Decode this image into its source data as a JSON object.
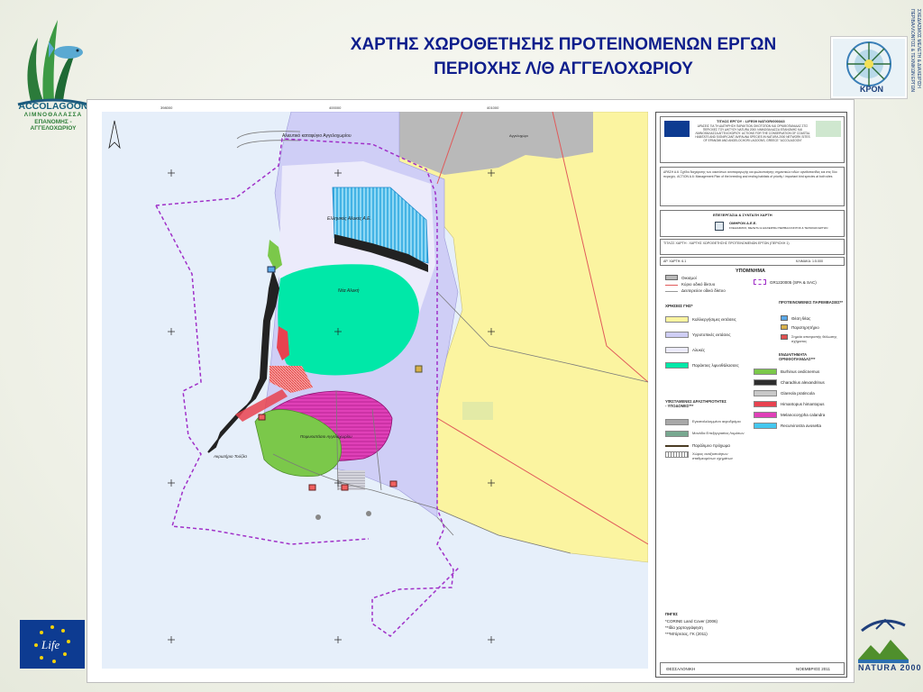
{
  "slide": {
    "title_line1": "ΧΑΡΤΗΣ ΧΩΡΟΘΕΤΗΣΗΣ ΠΡΟΤΕΙΝΟΜΕΝΩΝ ΕΡΓΩΝ",
    "title_line2": "ΠΕΡΙΟΧΗΣ Λ/Θ ΑΓΓΕΛΟΧΩΡΙΟΥ"
  },
  "logos": {
    "accolagoon_name": "ACCOLAGOON",
    "accolagoon_sub1": "ΛΙΜΝΟΘΑΛΑΣΣΑ",
    "accolagoon_sub2": "ΕΠΑΝΟΜΗΣ - ΑΓΓΕΛΟΧΩΡΙΟΥ",
    "kpon": "KPON",
    "right_vertical": "ΣΧΕΔΙΑΣΜΟΣ ΜΕΛΕΤΗ & ΔΙΑΧΕΙΡΙΣΗ ΠΕΡΙΒΑΛΛΟΝΤΟΣ & ΤΕΧΝΙΚΩΝ ΕΡΓΩΝ",
    "natura": "NATURA 2000",
    "life": "Life"
  },
  "map": {
    "grid_top": [
      "398000",
      "400000",
      "401000"
    ],
    "grid_left": [
      "4493000",
      "4491000",
      "4489000"
    ],
    "labels": {
      "fishery": "Αλιευτικό καταφύγιο Αγγελοχωρίου",
      "salt_company": "Ελληνικές Αλυκές Α.Ε.",
      "nw_salina": "Νέα Αλυκή",
      "lagoon": "Ποιμνιοστάσιο Αγγελοχωρίου",
      "cape": "Ακρωτήριο Τούζλα",
      "village": "Αγγελοχώρι"
    }
  },
  "legend": {
    "project_title": "ΤΙΤΛΟΣ ΕΡΓΟΥ : LIFE09 NAT/GR/000343",
    "project_desc": "ΔΡΑΣΕΙΣ ΓΙΑ ΤΗ ΔΙΑΤΗΡΗΣΗ ΠΑΡΑΚΤΙΩΝ ΟΙΚΟΤΟΠΩΝ ΚΑΙ ΟΡΝΙΘΟΠΑΝΙΔΑΣ ΣΤΙΣ ΠΕΡΙΟΧΕΣ ΤΟΥ ΔΙΚΤΥΟΥ NATURA 2000 ΛΙΜΝΟΘΑΛΑΣΣΑ ΕΠΑΝΟΜΗΣ ΚΑΙ ΛΙΜΝΟΘΑΛΑΣΣΑ ΑΓΓΕΛΟΧΩΡΙΟΥ. ACTIONS FOR THE CONSERVATION OF COASTAL HABITATS AND SIGNIFICANT AVIFAUNA SPECIES IN NATURA 2000 NETWORK SITES OF EPANOMI AND ANGELOCHORI LAGOONS, GREECE \"ACCOLAGOON\"",
    "action_desc": "ΔΡΑΣΗ Α.6: Σχέδιο διαχείρισης των οικοτόπων αναπαραγωγής και φωλεοποίησης σημαντικών ειδών ορνιθοπανίδας και στις δύο περιοχές. ACTION A.6: Management Plan of the breeding and resting habitats of priority / important bird species at both sites",
    "made_by_title": "ΕΠΕΞΕΡΓΑΣΙΑ & ΣΥΝΤΑΞΗ ΧΑΡΤΗ",
    "made_by_company": "ΟΜΗΡΟΝ Α.Ε.Ε.",
    "made_by_desc": "ΣΧΕΔΙΑΣΜΟΣ, ΜΕΛΕΤΗ & ΔΙΑΧΕΙΡΙΣΗ ΠΕΡΙΒΑΛΛΟΝΤΟΣ & ΤΕΧΝΙΚΩΝ ΕΡΓΩΝ",
    "map_title": "ΤΙΤΛΟΣ ΧΑΡΤΗ : ΧΑΡΤΗΣ ΧΩΡΟΘΕΤΗΣΗΣ ΠΡΟΤΕΙΝΟΜΕΝΩΝ ΕΡΓΩΝ (ΠΕΡΙΟΧΗ 1)",
    "map_no": "ΑΡ. ΧΑΡΤΗ: 6.1",
    "scale": "ΚΛΙΜΑΚΑ: 1:5.000",
    "heading": "ΥΠΟΜΝΗΜΑ",
    "legend_top": [
      {
        "label": "Οικισμοί",
        "color": "#b9b9b9"
      },
      {
        "label": "Κύριο οδικό δίκτυο",
        "color": "#e05a5a"
      },
      {
        "label": "Δευτερεύον οδικό δίκτυο",
        "color": "#999999"
      }
    ],
    "site_code": "GR1220005 (SPA & SAC)",
    "land_use_heading": "ΧΡΗΣΕΙΣ ΓΗΣ*",
    "land_use": [
      {
        "label": "Καλλιεργήσιμες εκτάσεις",
        "color": "#fbf4a0"
      },
      {
        "label": "Υγροτοπικές εκτάσεις",
        "color": "#cfcef6"
      },
      {
        "label": "Αλυκές",
        "color": "#ecebfb"
      },
      {
        "label": "Παράκτιες λιμνοθάλασσες",
        "color": "#00e8a8"
      }
    ],
    "proposed_heading": "ΠΡΟΤΕΙΝΟΜΕΝΕΣ ΠΑΡΕΜΒΑΣΕΙΣ**",
    "proposed": [
      {
        "label": "Θέση θέας",
        "color": "#5aa8e8"
      },
      {
        "label": "Παρατηρητήριο",
        "color": "#d8b04a"
      },
      {
        "label": "Σημεία αποτροπής θόλωσης σχήματος",
        "color": "#e05050"
      }
    ],
    "habitats_heading": "ΕΝΔΙΑΙΤΗΜΑΤΑ ΟΡΝΙΘΟΠΑΝΙΔΑΣ***",
    "habitats": [
      {
        "label": "Burhinus oedicnemus",
        "color": "#7bc84a"
      },
      {
        "label": "Charadrius alexandrinus",
        "color": "#2d2d2d"
      },
      {
        "label": "Glareola pratincola",
        "color": "#c8c8c8"
      },
      {
        "label": "Himantopus himantopus",
        "color": "#e8424f"
      },
      {
        "label": "Melanocorypha calandra",
        "color": "#e040b8"
      },
      {
        "label": "Recurvirostra avosetta",
        "color": "#44c7ef"
      }
    ],
    "existing_heading": "ΥΦΙΣΤΑΜΕΝΕΣ ΔΡΑΣΤΗΡΙΟΤΗΤΕΣ - ΥΠΟΔΟΜΕΣ***",
    "existing": [
      {
        "label": "Εγκαταλελειμμένο αεροδρόμιο",
        "color": "#a8a8a8"
      },
      {
        "label": "Μονάδα Επεξεργασίας Λυμάτων",
        "color": "#78a890"
      },
      {
        "label": "Παράλιμνο πρόχωμα",
        "color": "#4a3c24"
      },
      {
        "label": "Χώρος αναξιοποίητων σταθμευμένων οχημάτων",
        "color": "#d8d8d8"
      }
    ],
    "sources_heading": "ΠΗΓΕΣ",
    "sources": [
      "*CORINE Land Cover (2006)",
      "**Ιδία χαρτογράφηση",
      "***Μπίρτσας, ΓΚ (2011)"
    ],
    "footer_left": "ΘΕΣΣΑΛΟΝΙΚΗ",
    "footer_right": "ΝΟΕΜΒΡΙΟΣ 2011"
  },
  "colors": {
    "title": "#0e1e8c",
    "sea": "#e6effa",
    "agriculture": "#fbf4a0",
    "wetland": "#cfcef6",
    "lagoon": "#00e8a8",
    "natura_boundary": "#a030c8"
  }
}
